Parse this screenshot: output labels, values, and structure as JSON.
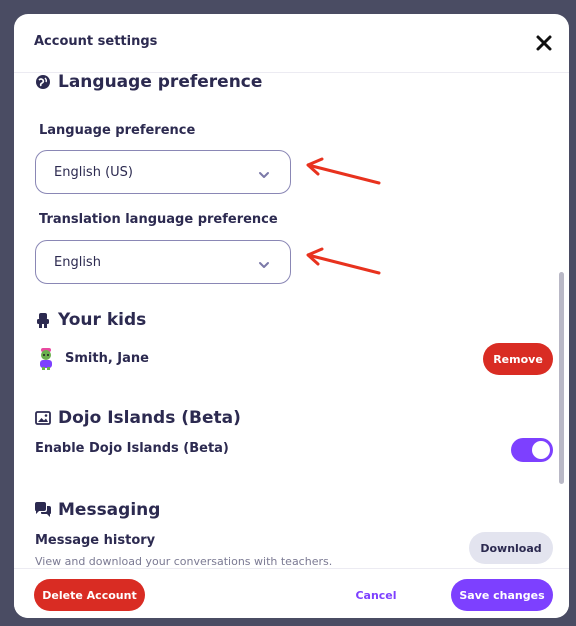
{
  "modal": {
    "title": "Account settings",
    "close_icon": "close-icon"
  },
  "language_section": {
    "heading": "Language preference",
    "icon": "globe-icon",
    "language_label": "Language preference",
    "language_value": "English (US)",
    "translation_label": "Translation language preference",
    "translation_value": "English"
  },
  "kids_section": {
    "heading": "Your kids",
    "icon": "kid-icon",
    "kid_name": "Smith, Jane",
    "remove_label": "Remove"
  },
  "islands_section": {
    "heading": "Dojo Islands (Beta)",
    "icon": "image-icon",
    "toggle_label": "Enable Dojo Islands (Beta)",
    "enabled": true
  },
  "messaging_section": {
    "heading": "Messaging",
    "icon": "chat-icon",
    "history_label": "Message history",
    "history_desc": "View and download your conversations with teachers.",
    "download_label": "Download"
  },
  "footer": {
    "delete_label": "Delete Account",
    "cancel_label": "Cancel",
    "save_label": "Save changes"
  },
  "colors": {
    "accent": "#7d40ff",
    "danger": "#d92c23",
    "annotation_arrow": "#e8321e",
    "text": "#2c2a50"
  }
}
